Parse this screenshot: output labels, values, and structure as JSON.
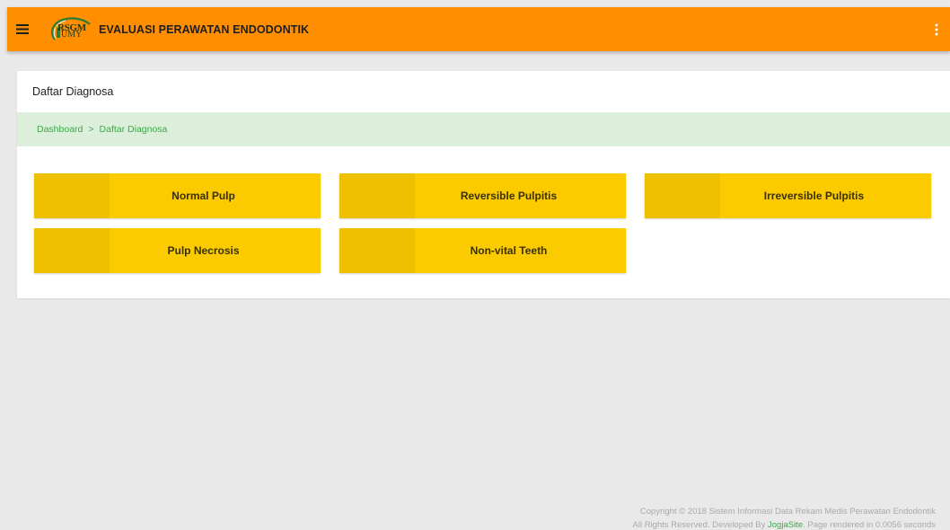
{
  "header": {
    "title": "EVALUASI PERAWATAN ENDODONTIK",
    "logo_text_top": "RSGM",
    "logo_text_bottom": "UMY",
    "menu_icon": "hamburger-icon",
    "more_icon": "more-vertical-icon",
    "bar_color": "#ff8f00"
  },
  "page": {
    "title": "Daftar Diagnosa"
  },
  "breadcrumb": {
    "items": [
      "Dashboard",
      "Daftar Diagnosa"
    ],
    "separator": ">"
  },
  "tiles": [
    {
      "label": "Normal Pulp"
    },
    {
      "label": "Reversible Pulpitis"
    },
    {
      "label": "Irreversible Pulpitis"
    },
    {
      "label": "Pulp Necrosis"
    },
    {
      "label": "Non-vital Teeth"
    }
  ],
  "tile_color": "#fbcb00",
  "footer": {
    "line1": "Copyright © 2018 Sistem Informasi Data Rekam Medis Perawatan Endodontik",
    "line2_prefix": "All Rights Reserved. Developed By",
    "brand": "JogjaSite",
    "line2_suffix": ". Page rendered in 0.0056 seconds"
  }
}
